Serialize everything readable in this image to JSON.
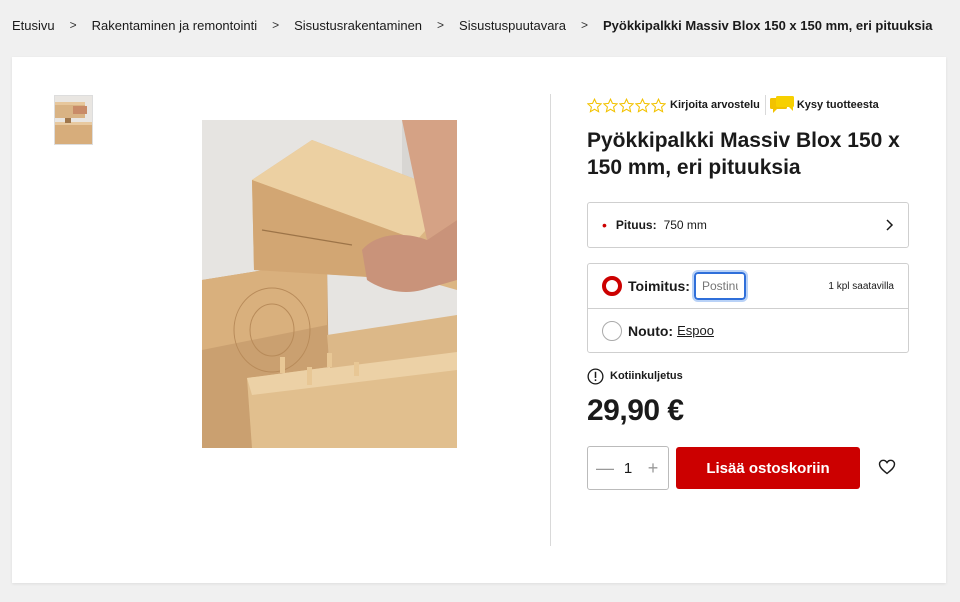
{
  "breadcrumb": {
    "items": [
      "Etusivu",
      "Rakentaminen ja remontointi",
      "Sisustusrakentaminen",
      "Sisustuspuutavara",
      "Pyökkipalkki Massiv Blox 150 x 150 mm, eri pituuksia"
    ],
    "separator": ">"
  },
  "gallery": {
    "thumbnail_icon": "product-thumbnail",
    "main_image_icon": "product-photo-wooden-blocks"
  },
  "rating": {
    "stars_filled": 0,
    "stars_total": 5,
    "star_color": "#f2c200",
    "write_review_label": "Kirjoita arvostelu",
    "ask_label": "Kysy tuotteesta",
    "ask_icon_color": "#f2c200"
  },
  "product": {
    "title": "Pyökkipalkki Massiv Blox 150 x 150 mm, eri pituuksia"
  },
  "variant": {
    "label": "Pituus:",
    "value": "750 mm"
  },
  "delivery": {
    "shipping_label": "Toimitus:",
    "postal_placeholder": "Postinumero",
    "stock_text": "1 kpl saatavilla",
    "pickup_label": "Nouto:",
    "pickup_store": "Espoo"
  },
  "home_delivery": {
    "label": "Kotiinkuljetus"
  },
  "price": {
    "value": "29,90 €"
  },
  "purchase": {
    "quantity": "1",
    "minus": "—",
    "plus": "+",
    "add_to_cart_label": "Lisää ostoskoriin"
  },
  "colors": {
    "accent": "#cc0000",
    "focus": "#2f6fda"
  }
}
